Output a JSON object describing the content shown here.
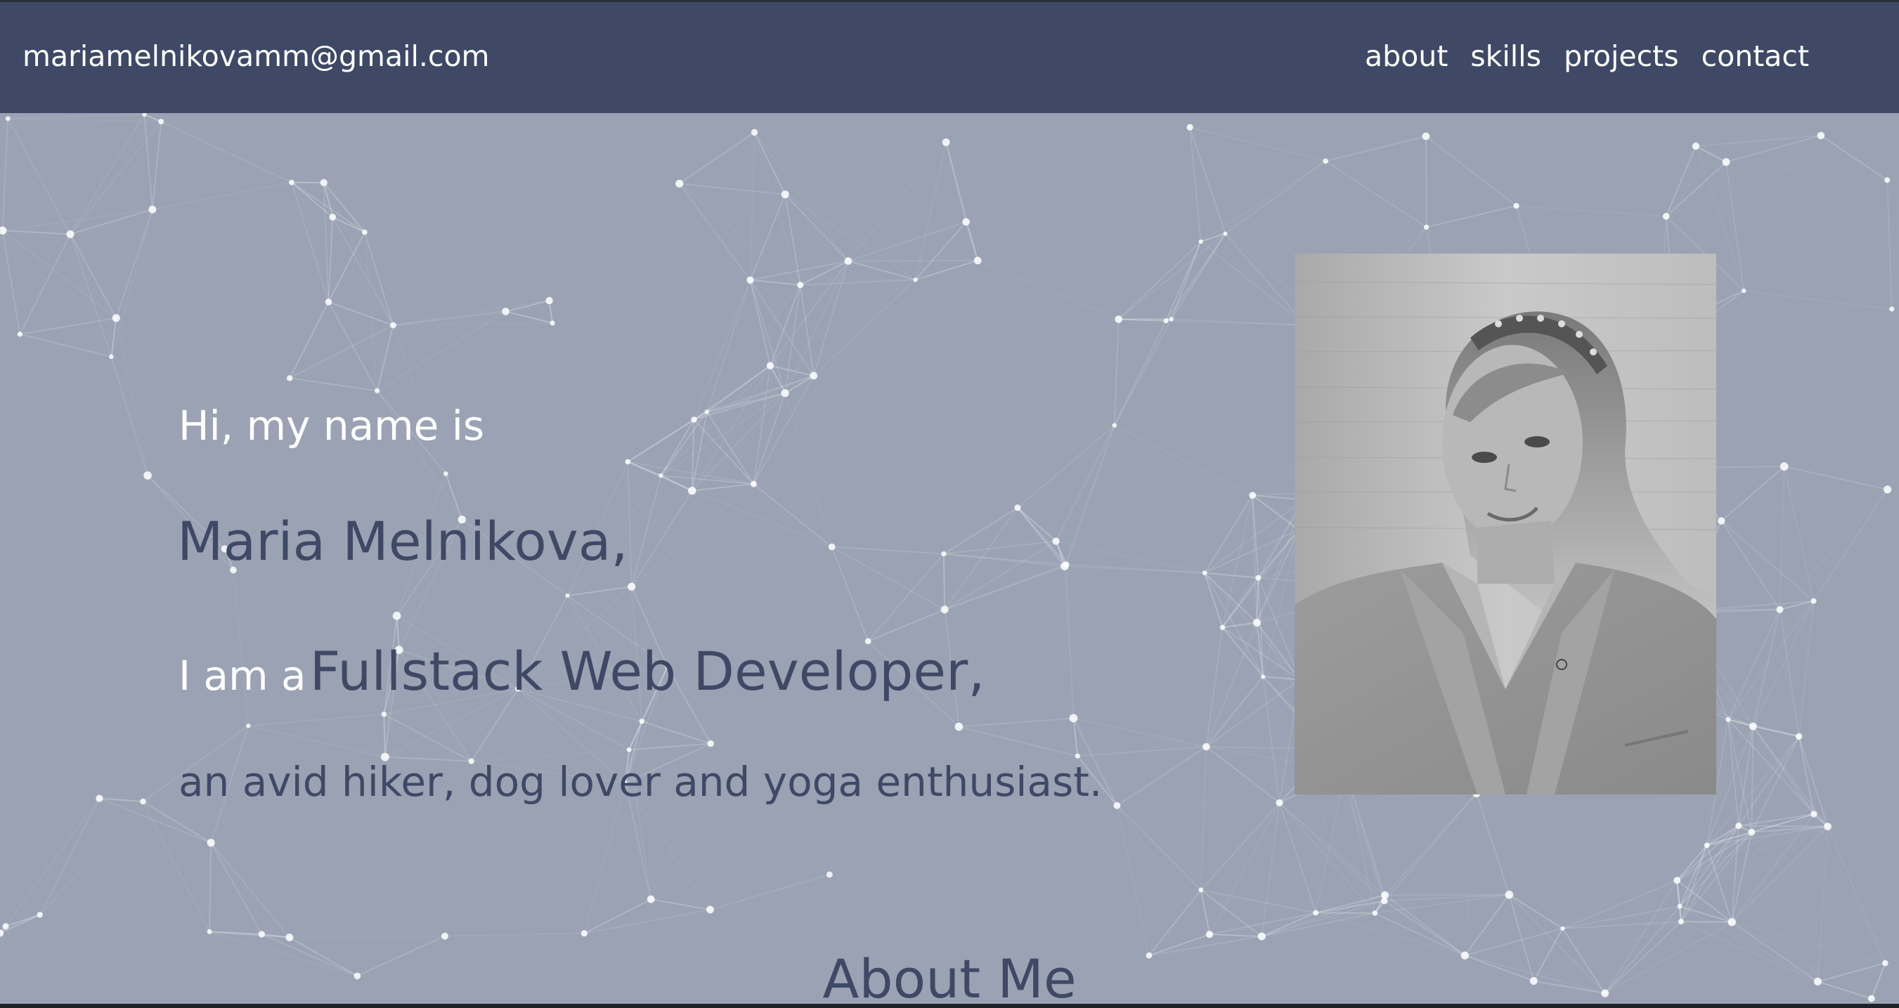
{
  "header": {
    "email": "mariamelnikovamm@gmail.com",
    "nav": [
      {
        "label": "about"
      },
      {
        "label": "skills"
      },
      {
        "label": "projects"
      },
      {
        "label": "contact"
      }
    ]
  },
  "hero": {
    "greeting": "Hi, my name is",
    "name": "Maria Melnikova,",
    "role_prefix": "I am a",
    "role_title": "Fullstack Web Developer,",
    "hobbies": "an avid hiker, dog lover and yoga enthusiast."
  },
  "about": {
    "heading": "About Me"
  },
  "colors": {
    "navbar_bg": "#3f4966",
    "hero_bg": "#9aa2b3",
    "accent_text": "#3f4966",
    "light_text": "#ffffff"
  },
  "icons": {
    "background": "particle-network-background",
    "photo": "profile-portrait-photo"
  }
}
